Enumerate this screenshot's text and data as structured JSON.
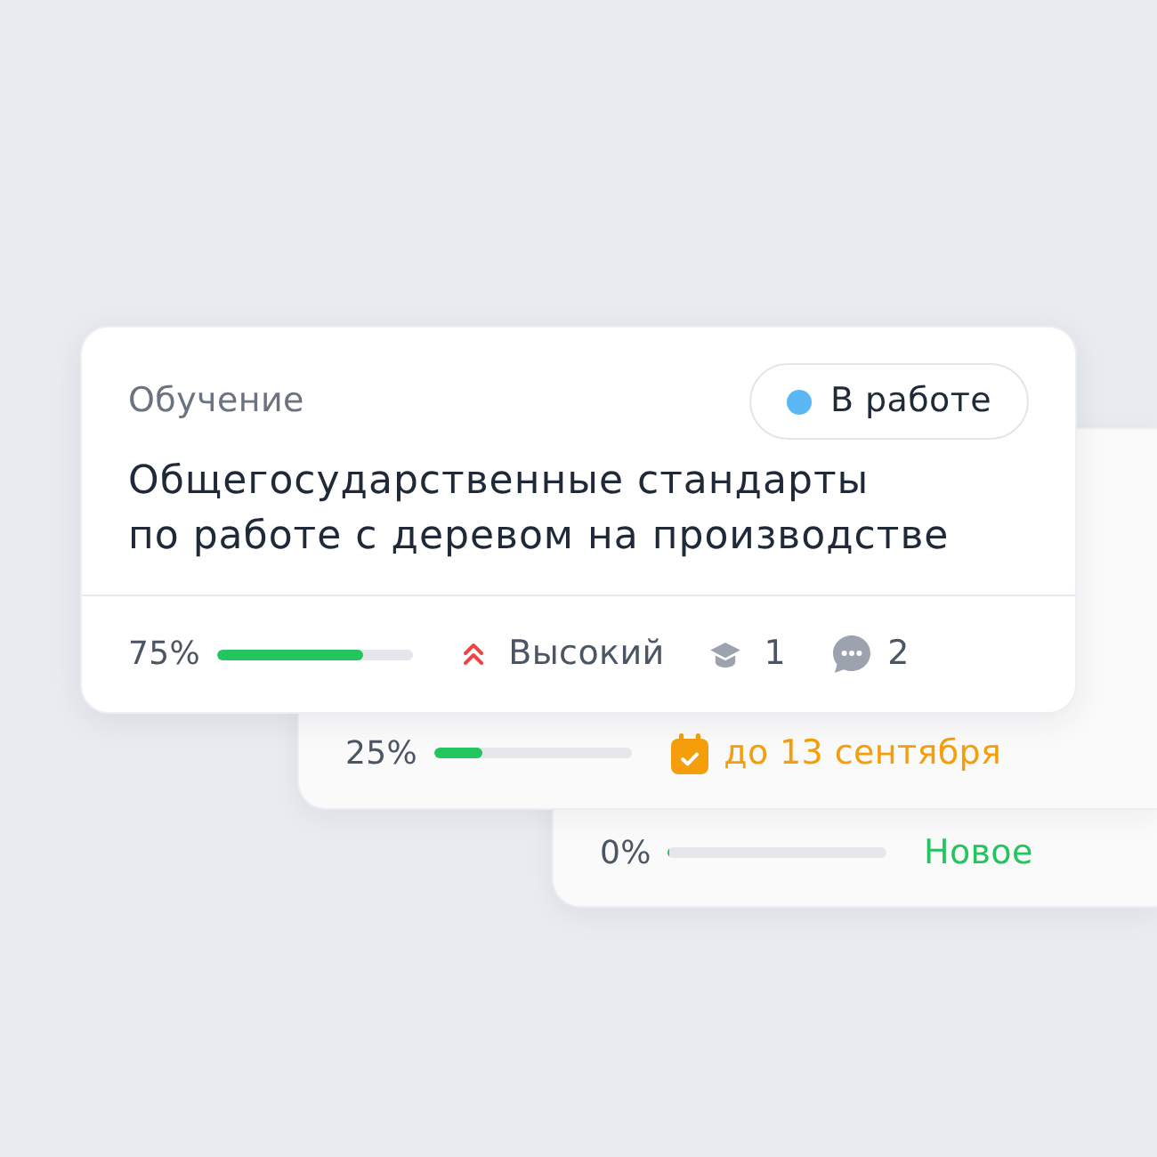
{
  "cards": [
    {
      "category": "Обучение",
      "status": {
        "label": "В работе",
        "color": "#5cb8f5"
      },
      "title": "Общегосударственные стандарты\nпо работе с деревом на производстве",
      "progress": {
        "reading": "75%",
        "level": 0.75
      },
      "meta": [
        {
          "kind": "priority",
          "label": "Высокий"
        },
        {
          "kind": "courses",
          "label": "1"
        },
        {
          "kind": "comments",
          "label": "2"
        }
      ]
    },
    {
      "progress": {
        "reading": "25%",
        "level": 0.25
      },
      "meta": [
        {
          "kind": "deadline",
          "label": "до 13 сентября"
        }
      ]
    },
    {
      "progress": {
        "reading": "0%",
        "level": 0
      },
      "meta": [
        {
          "kind": "state",
          "label": "Новое"
        }
      ]
    }
  ]
}
